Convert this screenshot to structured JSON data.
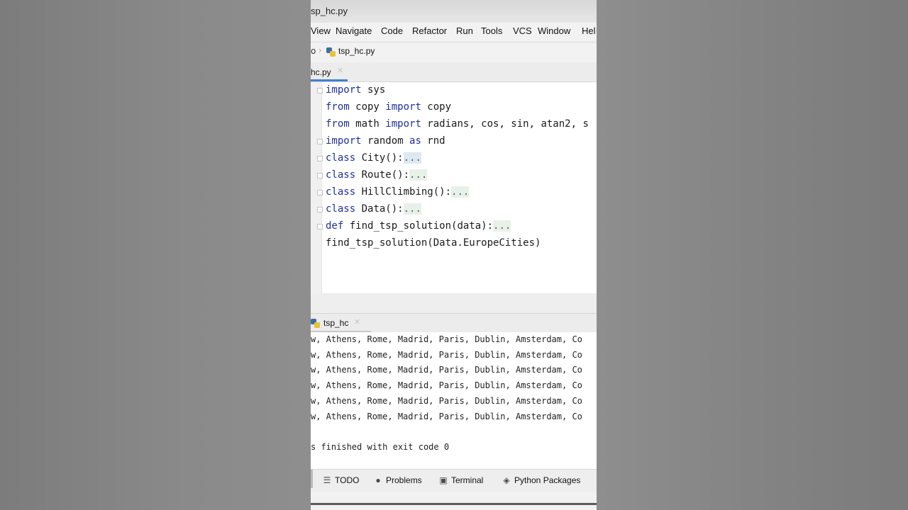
{
  "window": {
    "title": "sp_hc.py"
  },
  "menu": [
    "View",
    "Navigate",
    "Code",
    "Refactor",
    "Run",
    "Tools",
    "VCS",
    "Window",
    "Hel"
  ],
  "breadcrumb": {
    "fragment": "o",
    "file": "tsp_hc.py"
  },
  "editor_tab": {
    "label": "hc.py"
  },
  "code": {
    "lines": [
      {
        "kw": "import",
        "text": " sys"
      },
      {
        "kw": "from",
        "text": " copy ",
        "kw2": "import",
        "text2": " copy"
      },
      {
        "kw": "from",
        "text": " math ",
        "kw2": "import",
        "text2": " radians, cos, sin, atan2, s"
      },
      {
        "kw": "import",
        "text": " random ",
        "kw2": "as",
        "text2": " rnd"
      },
      {
        "kw": "class",
        "text": " City():",
        "fold": "..."
      },
      {
        "kw": "class",
        "text": " Route():",
        "fold": "..."
      },
      {
        "kw": "class",
        "text": " HillClimbing():",
        "fold": "..."
      },
      {
        "kw": "class",
        "text": " Data():",
        "fold": "..."
      },
      {
        "kw": "def",
        "text": " find_tsp_solution(data):",
        "fold": "..."
      },
      {
        "text": "find_tsp_solution(Data.EuropeCities)"
      }
    ]
  },
  "run_tab": {
    "label": "tsp_hc"
  },
  "console": {
    "lines": [
      "w, Athens, Rome, Madrid, Paris, Dublin, Amsterdam, Co",
      "w, Athens, Rome, Madrid, Paris, Dublin, Amsterdam, Co",
      "w, Athens, Rome, Madrid, Paris, Dublin, Amsterdam, Co",
      "w, Athens, Rome, Madrid, Paris, Dublin, Amsterdam, Co",
      "w, Athens, Rome, Madrid, Paris, Dublin, Amsterdam, Co",
      "w, Athens, Rome, Madrid, Paris, Dublin, Amsterdam, Co"
    ],
    "exit": "s finished with exit code 0"
  },
  "toolbar": {
    "todo": "TODO",
    "problems": "Problems",
    "terminal": "Terminal",
    "python_packages": "Python Packages"
  }
}
